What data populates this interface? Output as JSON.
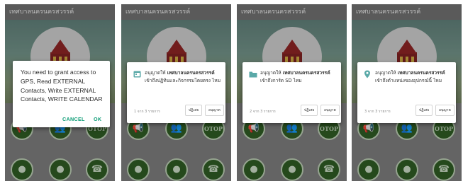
{
  "app_title": "เทศบาลนครนครสวรรค์",
  "phone1": {
    "dialog": {
      "message": "You need to grant access to GPS, Read EXTERNAL Contacts, Write EXTERNAL Contacts, WRITE CALENDAR",
      "cancel_label": "CANCEL",
      "ok_label": "OK"
    }
  },
  "permission_prefix": "อนุญาตให้",
  "app_name_bold": "เทศบาลนครนครสวรรค์",
  "deny_label": "ปฏิเสธ",
  "allow_label": "อนุญาต",
  "phone2": {
    "icon": "calendar-icon",
    "suffix": "เข้าถึงปฏิทินและกิจกรรมโดยตรง ไหม",
    "counter": "1 จาก 3 รายการ"
  },
  "phone3": {
    "icon": "folder-icon",
    "suffix": "เข้าถึงการ์ด SD ไหม",
    "counter": "2 จาก 3 รายการ"
  },
  "phone4": {
    "icon": "location-pin-icon",
    "suffix": "เข้าถึงตำแหน่งของอุปกรณ์นี้ ไหม",
    "counter": "3 จาก 3 รายการ"
  },
  "otop_label": "OTOP",
  "colors": {
    "dialog_accent": "#0f9d77",
    "icon_accent": "#5aa9a8",
    "tile_green": "#2e5a23"
  }
}
